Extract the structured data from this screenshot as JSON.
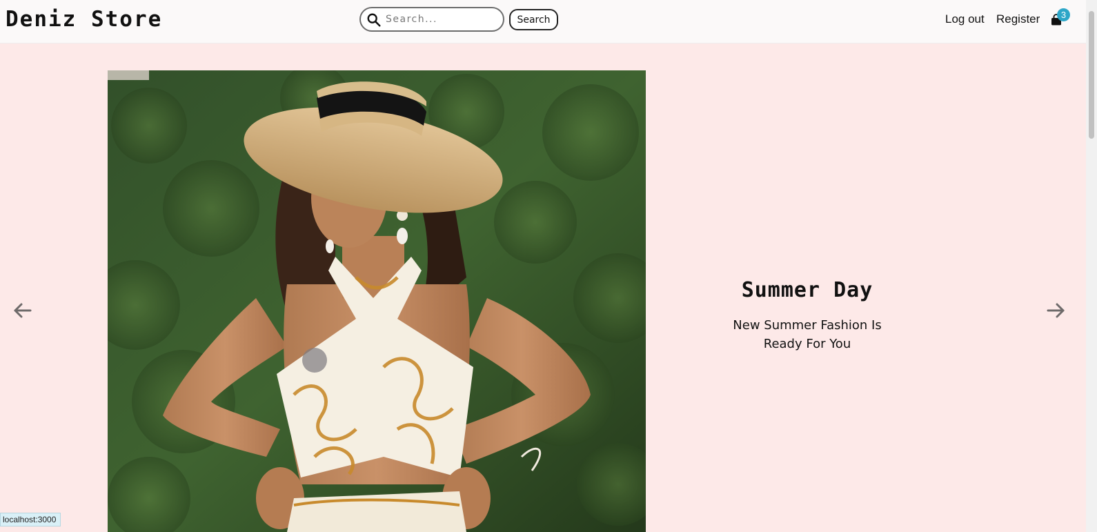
{
  "header": {
    "brand": "Deniz Store",
    "search": {
      "placeholder": "Search...",
      "value": "",
      "button_label": "Search"
    },
    "nav": {
      "logout_label": "Log out",
      "register_label": "Register"
    },
    "cart": {
      "count": "3",
      "icon": "shopping-bag-icon"
    }
  },
  "slider": {
    "prev_icon": "arrow-left-icon",
    "next_icon": "arrow-right-icon",
    "slide": {
      "title": "Summer Day",
      "description": "New Summer Fashion Is Ready For You"
    }
  },
  "status_bar": {
    "url": "localhost:3000"
  },
  "colors": {
    "page_background": "#fde9e8",
    "header_background": "#fbf9f9",
    "badge": "#2da6c8"
  }
}
